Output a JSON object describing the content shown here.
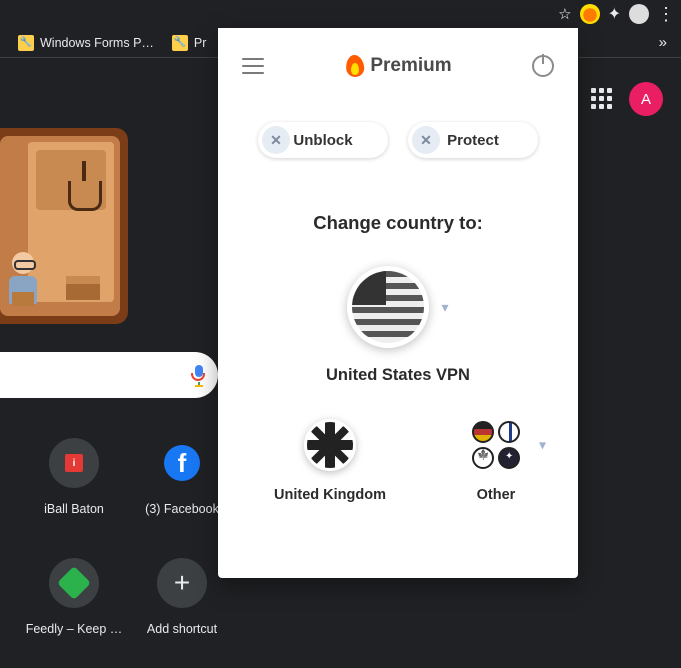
{
  "toolbar": {
    "extension_tooltip": "Hola"
  },
  "bookmarks": {
    "items": [
      {
        "label": "Windows Forms P…"
      },
      {
        "label": "Pr"
      }
    ]
  },
  "ntp": {
    "profile_letter": "A",
    "shortcuts": [
      {
        "label": "iBall Baton"
      },
      {
        "label": "(3) Facebook"
      },
      {
        "label": "Feedly – Keep …"
      },
      {
        "label": "Add shortcut"
      }
    ]
  },
  "popup": {
    "brand": "Premium",
    "pill_unblock": "Unblock",
    "pill_protect": "Protect",
    "heading": "Change country to:",
    "primary_country": "United States VPN",
    "secondary_uk": "United Kingdom",
    "secondary_other": "Other"
  }
}
